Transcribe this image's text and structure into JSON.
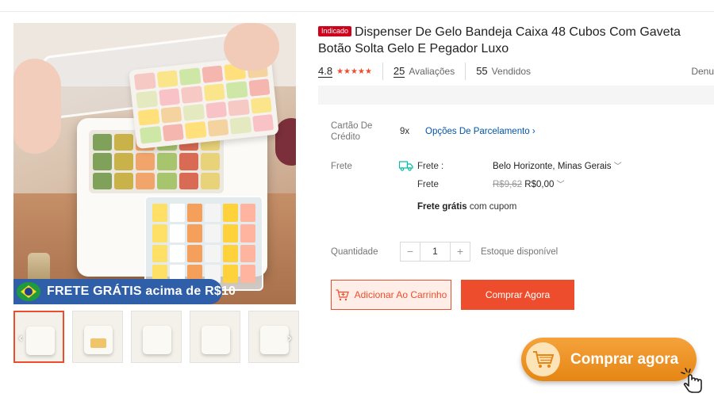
{
  "gallery": {
    "promo_banner": "FRETE GRÁTIS acima de R$10",
    "thumbnails": [
      {
        "name": "thumb-1",
        "active": true
      },
      {
        "name": "thumb-2",
        "active": false
      },
      {
        "name": "thumb-3",
        "active": false
      },
      {
        "name": "thumb-4",
        "active": false
      },
      {
        "name": "thumb-5",
        "active": false
      }
    ]
  },
  "product": {
    "badge": "Indicado",
    "title": "Dispenser De Gelo Bandeja Caixa 48 Cubos Com Gaveta Botão Solta Gelo E Pegador Luxo",
    "rating": "4.8",
    "stars": 5,
    "reviews_count": "25",
    "reviews_label": "Avaliações",
    "sold_count": "55",
    "sold_label": "Vendidos",
    "report_label": "Denu"
  },
  "payment": {
    "label": "Cartão De Crédito",
    "installments": "9x",
    "options_link": "Opções De Parcelamento"
  },
  "shipping": {
    "label": "Frete",
    "to_label": "Frete :",
    "destination": "Belo Horizonte, Minas Gerais",
    "cost_label": "Frete",
    "old_price": "R$9,62",
    "new_price": "R$0,00",
    "free_bold": "Frete grátis",
    "free_rest": "com cupom"
  },
  "quantity": {
    "label": "Quantidade",
    "minus": "−",
    "value": "1",
    "plus": "+",
    "stock": "Estoque disponível"
  },
  "actions": {
    "add_to_cart": "Adicionar Ao Carrinho",
    "buy_now": "Comprar Agora"
  },
  "cta": {
    "label": "Comprar agora"
  },
  "colors": {
    "accent": "#ee4d2d",
    "cta": "#f09a2a",
    "promo_banner": "#2f5fa8"
  }
}
